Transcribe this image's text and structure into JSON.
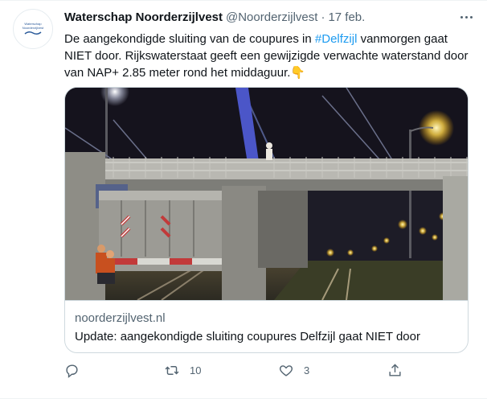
{
  "tweet": {
    "author_name": "Waterschap Noorderzijlvest",
    "handle": "@Noorderzijlvest",
    "separator": "·",
    "date": "17 feb.",
    "avatar_text": "Waterschap Noorderzijlvest",
    "text_before_tag": "De aangekondigde sluiting van de coupures in ",
    "hashtag": "#Delfzijl",
    "text_after_tag": " vanmorgen gaat NIET door. Rijkswaterstaat geeft een gewijzigde verwachte waterstand door van NAP+ 2.85 meter rond het middaguur.",
    "emoji": "👇"
  },
  "card": {
    "domain": "noorderzijlvest.nl",
    "title": "Update: aangekondigde sluiting coupures Delfzijl gaat NIET door"
  },
  "actions": {
    "reply_count": "",
    "retweet_count": "10",
    "like_count": "3"
  },
  "colors": {
    "accent": "#1d9bf0",
    "secondary_text": "#536471",
    "border": "#cfd9de"
  }
}
